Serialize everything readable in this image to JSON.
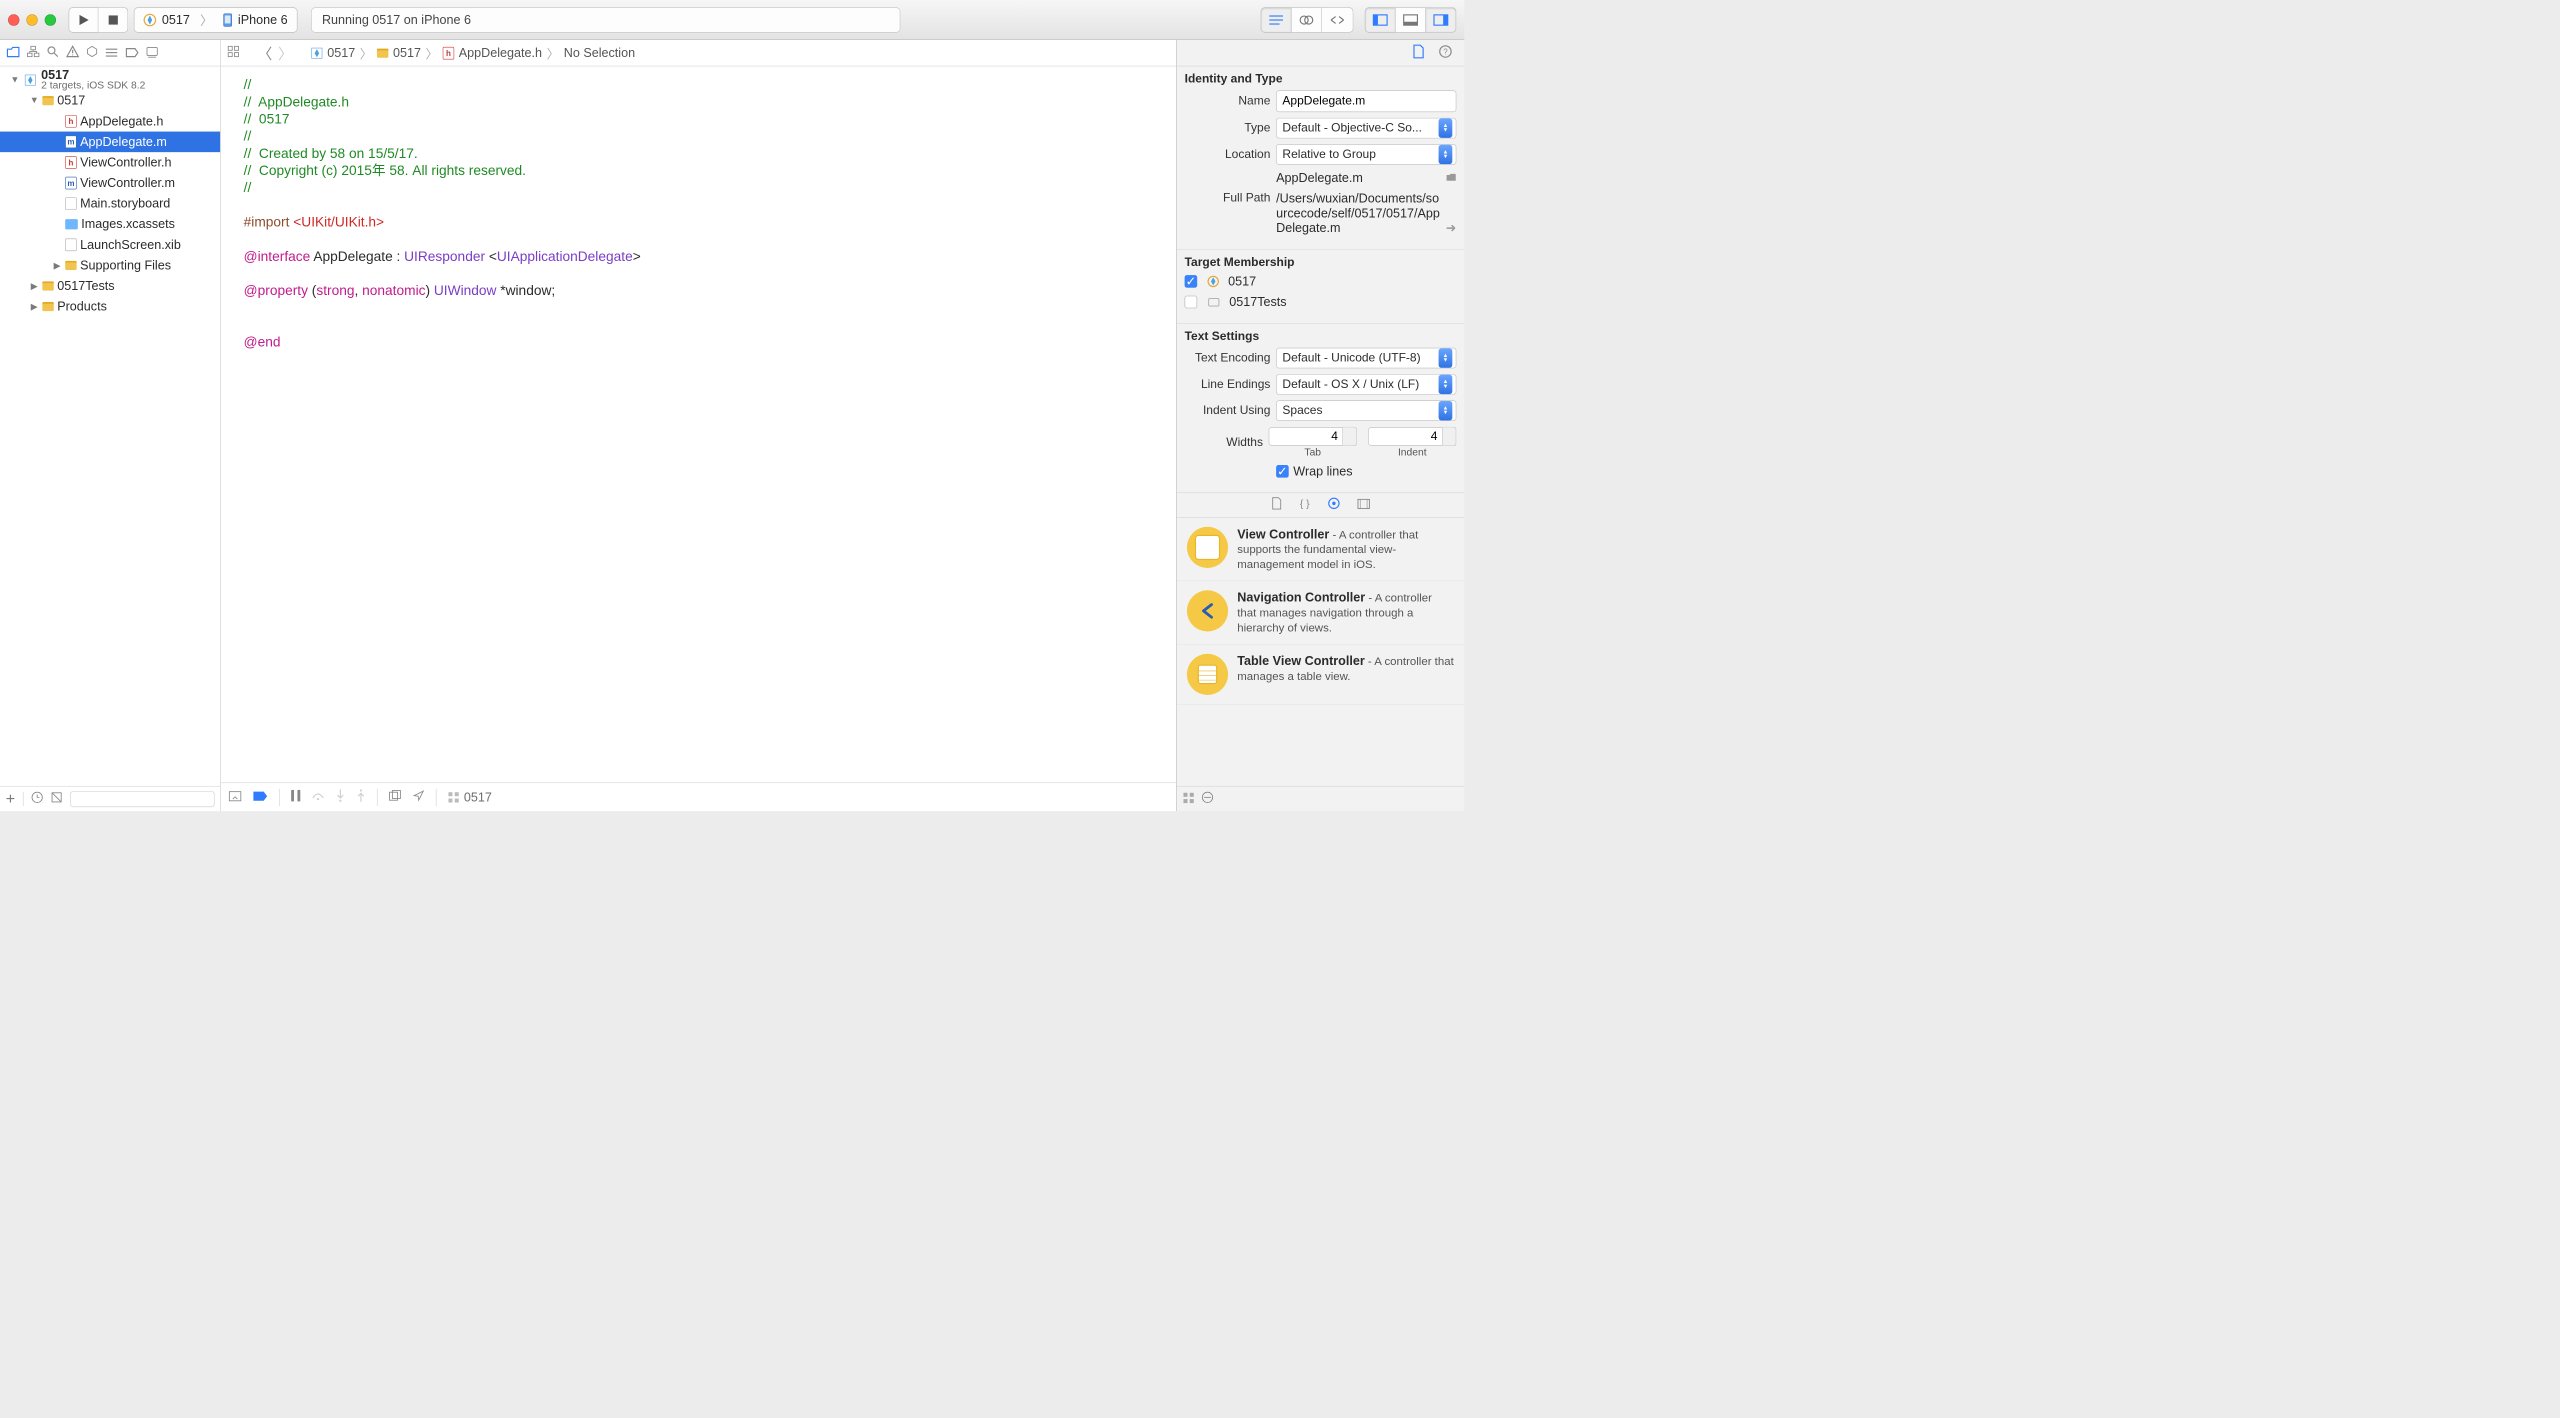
{
  "toolbar": {
    "scheme_target": "0517",
    "scheme_device": "iPhone 6",
    "status": "Running 0517 on iPhone 6"
  },
  "navigator": {
    "project": "0517",
    "project_sub": "2 targets, iOS SDK 8.2",
    "items": [
      {
        "kind": "folder",
        "label": "0517",
        "depth": 2,
        "disc": "▼"
      },
      {
        "kind": "h",
        "label": "AppDelegate.h",
        "depth": 3,
        "disc": ""
      },
      {
        "kind": "m",
        "label": "AppDelegate.m",
        "depth": 3,
        "disc": "",
        "selected": true
      },
      {
        "kind": "h",
        "label": "ViewController.h",
        "depth": 3,
        "disc": ""
      },
      {
        "kind": "m",
        "label": "ViewController.m",
        "depth": 3,
        "disc": ""
      },
      {
        "kind": "sb",
        "label": "Main.storyboard",
        "depth": 3,
        "disc": ""
      },
      {
        "kind": "assets",
        "label": "Images.xcassets",
        "depth": 3,
        "disc": ""
      },
      {
        "kind": "sb",
        "label": "LaunchScreen.xib",
        "depth": 3,
        "disc": ""
      },
      {
        "kind": "folder",
        "label": "Supporting Files",
        "depth": 3,
        "disc": "▶"
      },
      {
        "kind": "folder",
        "label": "0517Tests",
        "depth": 2,
        "disc": "▶"
      },
      {
        "kind": "folder",
        "label": "Products",
        "depth": 2,
        "disc": "▶"
      }
    ]
  },
  "jump": {
    "project": "0517",
    "folder": "0517",
    "file": "AppDelegate.h",
    "selection": "No Selection"
  },
  "code": {
    "l1": "//",
    "l2": "//  AppDelegate.h",
    "l3": "//  0517",
    "l4": "//",
    "l5": "//  Created by 58 on 15/5/17.",
    "l6": "//  Copyright (c) 2015年 58. All rights reserved.",
    "l7": "//",
    "imp1": "#import ",
    "imp2": "<UIKit/UIKit.h>",
    "if1": "@interface",
    "if2": " AppDelegate : ",
    "if3": "UIResponder",
    "if4": " <",
    "if5": "UIApplicationDelegate",
    "if6": ">",
    "pr1": "@property",
    "pr2": " (",
    "pr3": "strong",
    "pr4": ", ",
    "pr5": "nonatomic",
    "pr6": ") ",
    "pr7": "UIWindow",
    "pr8": " *window;",
    "end": "@end"
  },
  "debug": {
    "process": "0517"
  },
  "inspector": {
    "identity_header": "Identity and Type",
    "name_label": "Name",
    "name_value": "AppDelegate.m",
    "type_label": "Type",
    "type_value": "Default - Objective-C So...",
    "location_label": "Location",
    "location_value": "Relative to Group",
    "location_file": "AppDelegate.m",
    "fullpath_label": "Full Path",
    "fullpath_value": "/Users/wuxian/Documents/sourcecode/self/0517/0517/AppDelegate.m",
    "target_header": "Target Membership",
    "target1": "0517",
    "target2": "0517Tests",
    "text_header": "Text Settings",
    "enc_label": "Text Encoding",
    "enc_value": "Default - Unicode (UTF-8)",
    "le_label": "Line Endings",
    "le_value": "Default - OS X / Unix (LF)",
    "indent_label": "Indent Using",
    "indent_value": "Spaces",
    "widths_label": "Widths",
    "tab_val": "4",
    "indent_val": "4",
    "tab_sub": "Tab",
    "indent_sub": "Indent",
    "wrap_label": "Wrap lines",
    "lib": [
      {
        "title": "View Controller",
        "desc": " - A controller that supports the fundamental view-management model in iOS."
      },
      {
        "title": "Navigation Controller",
        "desc": " - A controller that manages navigation through a hierarchy of views."
      },
      {
        "title": "Table View Controller",
        "desc": " - A controller that manages a table view."
      }
    ]
  }
}
